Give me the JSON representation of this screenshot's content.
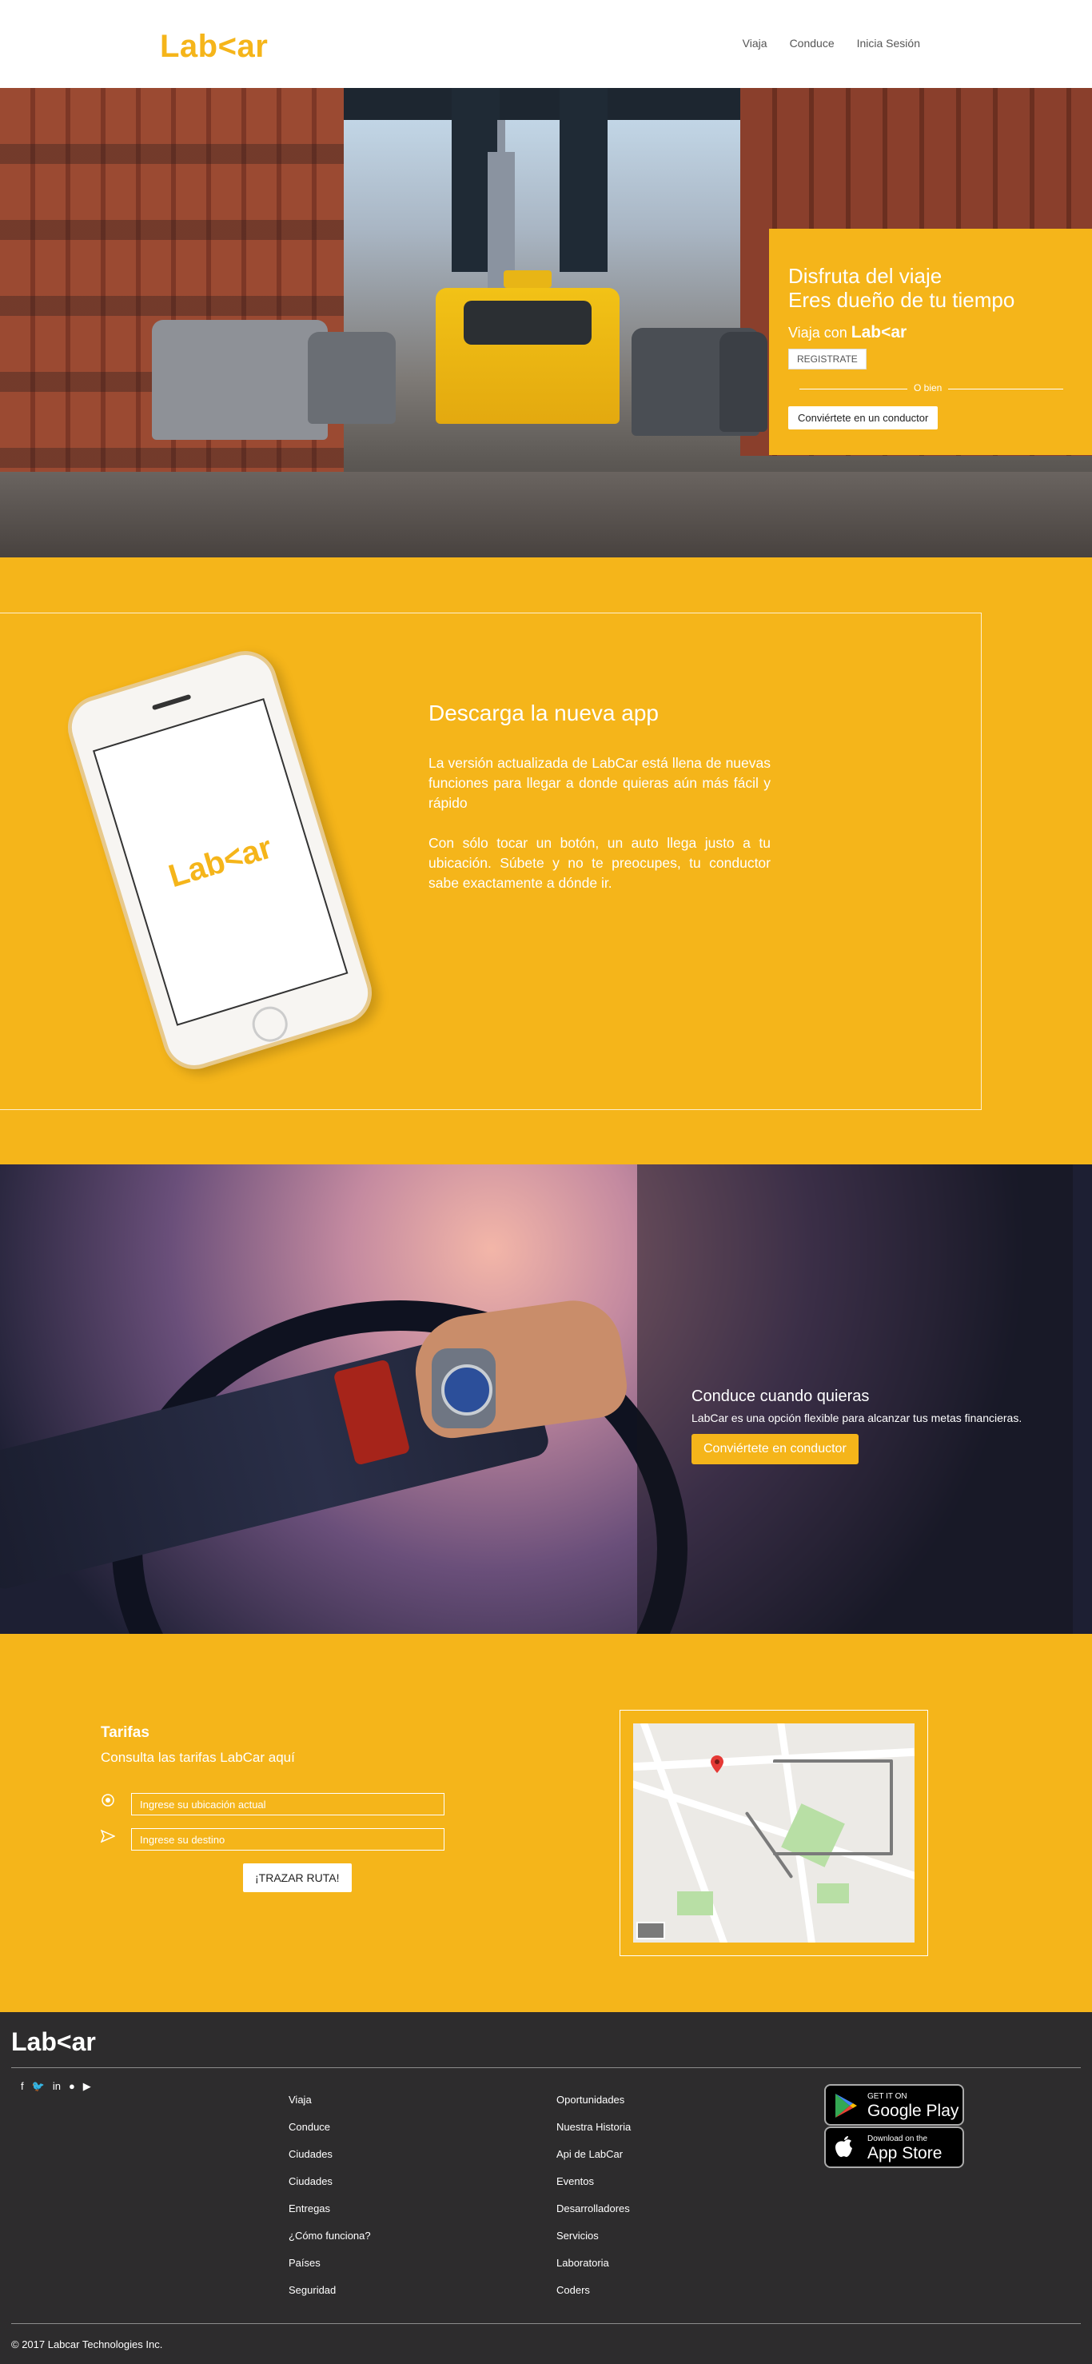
{
  "header": {
    "logo": "Lab<ar",
    "nav": [
      "Viaja",
      "Conduce",
      "Inicia Sesión"
    ]
  },
  "hero": {
    "title_line1": "Disfruta del viaje",
    "title_line2": "Eres dueño de tu tiempo",
    "viaja_prefix": "Viaja con",
    "viaja_brand": "Lab<ar",
    "register_button": "REGISTRATE",
    "divider_text": "O bien",
    "driver_button": "Conviértete en un conductor"
  },
  "app": {
    "phone_logo": "Lab<ar",
    "title": "Descarga la nueva app",
    "paragraph1": "La versión actualizada de LabCar está llena de nuevas funciones para llegar a donde quieras aún más fácil y rápido",
    "paragraph2": "Con sólo tocar un botón, un auto llega justo a tu ubicación. Súbete y no te preocupes, tu conductor sabe exactamente a dónde ir."
  },
  "driver": {
    "title": "Conduce cuando quieras",
    "subtitle": "LabCar es una opción flexible para alcanzar tus metas financieras.",
    "button": "Conviértete en conductor"
  },
  "fares": {
    "title": "Tarifas",
    "subtitle": "Consulta las tarifas LabCar aquí",
    "origin_placeholder": "Ingrese su ubicación actual",
    "destination_placeholder": "Ingrese su destino",
    "route_button": "¡TRAZAR RUTA!"
  },
  "footer": {
    "logo": "Lab<ar",
    "col1": [
      "Viaja",
      "Conduce",
      "Ciudades",
      "Ciudades",
      "Entregas",
      "¿Cómo funciona?",
      "Países",
      "Seguridad"
    ],
    "col2": [
      "Oportunidades",
      "Nuestra Historia",
      "Api de LabCar",
      "Eventos",
      "Desarrolladores",
      "Servicios",
      "Laboratoria",
      "Coders"
    ],
    "google_play_small": "GET IT ON",
    "google_play_big": "Google Play",
    "app_store_small": "Download on the",
    "app_store_big": "App Store",
    "copyright": "© 2017 Labcar Technologies Inc."
  }
}
